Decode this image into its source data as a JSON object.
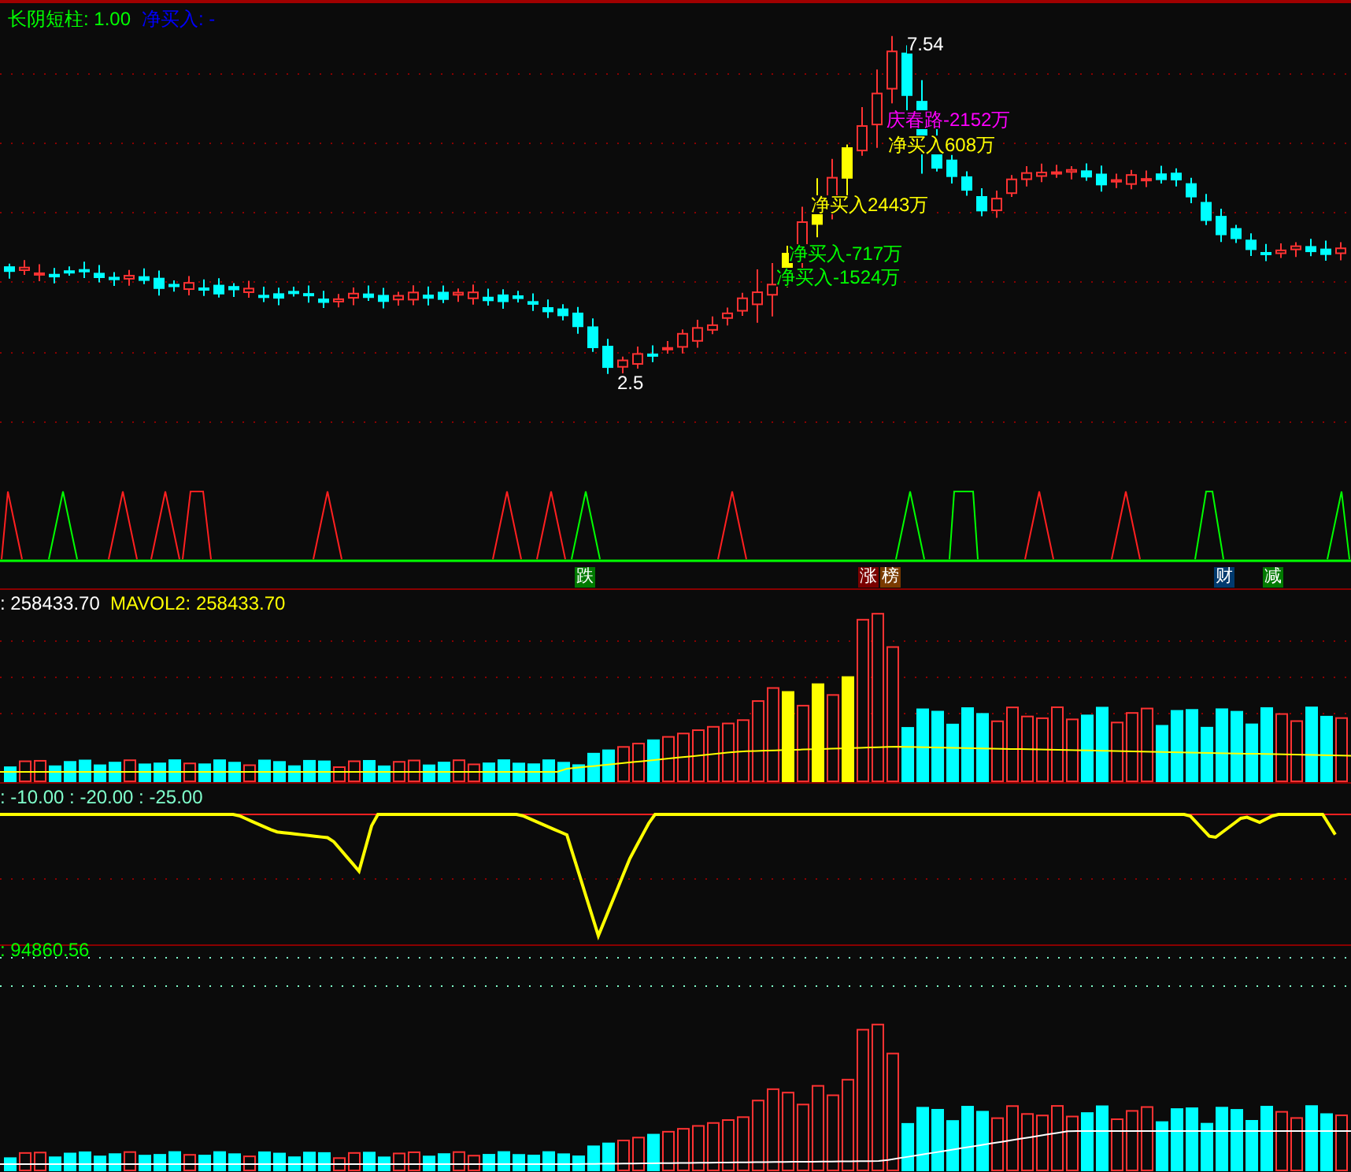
{
  "main_pane": {
    "header": [
      {
        "text": "长阴短柱: 1.00",
        "color": "#00ff00"
      },
      {
        "text": "净买入: -",
        "color": "#0000ff"
      }
    ],
    "annotations": [
      {
        "text": "7.54",
        "color": "#ffffff"
      },
      {
        "text": "庆春路-2152万",
        "color": "#ff00ff"
      },
      {
        "text": "净买入608万",
        "color": "#ffff00"
      },
      {
        "text": "净买入2443万",
        "color": "#ffff00"
      },
      {
        "text": "净买入-717万",
        "color": "#00ff00"
      },
      {
        "text": "净买入-1524万",
        "color": "#00ff00"
      },
      {
        "text": "2.5",
        "color": "#ffffff"
      }
    ],
    "tags": [
      {
        "text": "跌",
        "color": "#007a00"
      },
      {
        "text": "涨",
        "color": "#7a0000"
      },
      {
        "text": "榜",
        "color": "#7a3a00"
      },
      {
        "text": "财",
        "color": "#003a6e"
      },
      {
        "text": "减",
        "color": "#007a00"
      }
    ]
  },
  "volume_pane": {
    "header": [
      {
        "text": ": 258433.70",
        "color": "#ffffff"
      },
      {
        "text": "MAVOL2: 258433.70",
        "color": "#ffff00"
      }
    ]
  },
  "line_pane": {
    "header": [
      {
        "text": ": -10.00 : -20.00 : -25.00",
        "color": "#80ffcc"
      }
    ]
  },
  "bottom_pane": {
    "header": [
      {
        "text": ": 94860.56",
        "color": "#00ff00"
      }
    ]
  }
}
